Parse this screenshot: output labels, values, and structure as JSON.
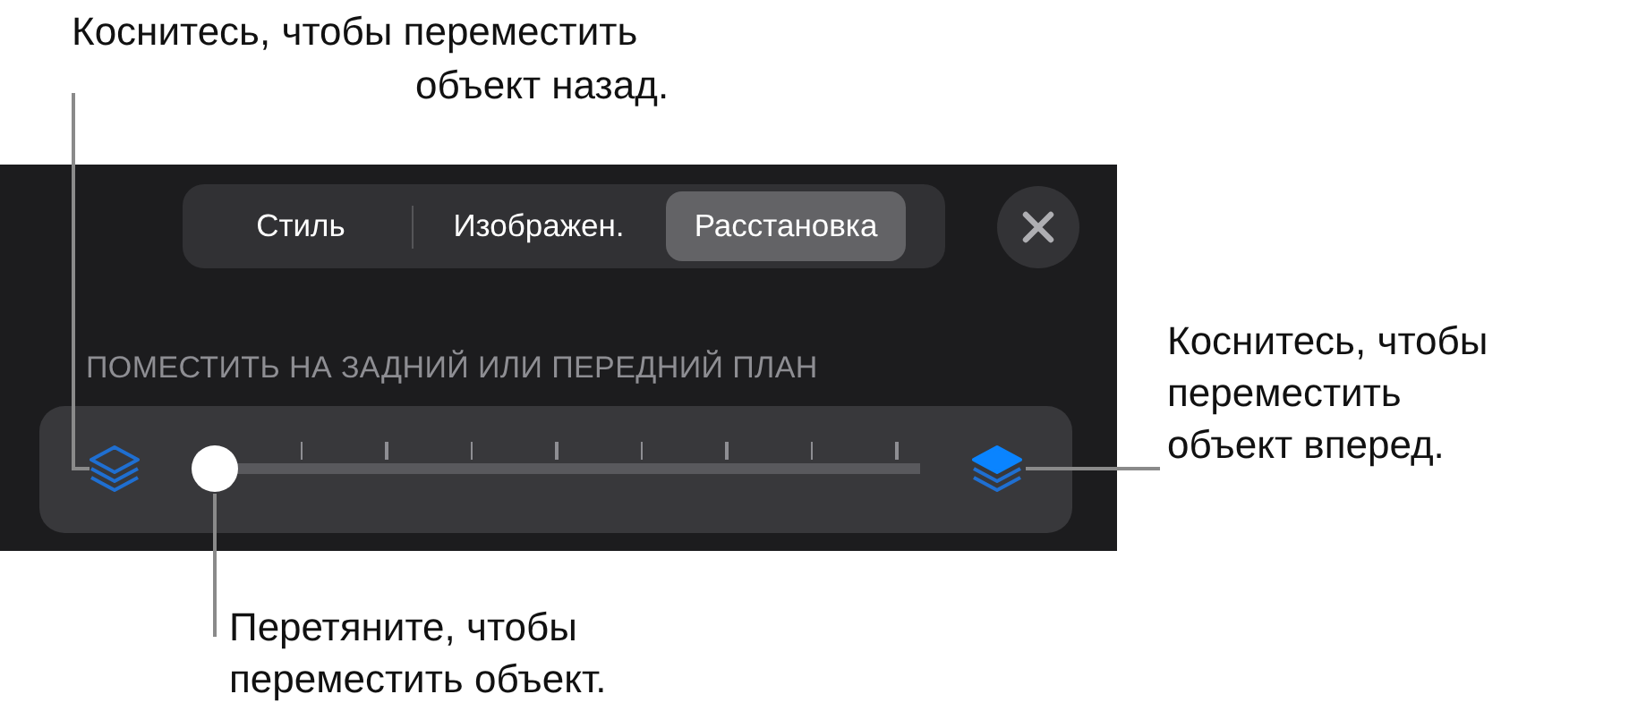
{
  "panel": {
    "tabs": [
      {
        "label": "Стиль",
        "selected": false
      },
      {
        "label": "Изображен.",
        "selected": false
      },
      {
        "label": "Расстановка",
        "selected": true
      }
    ],
    "section_header": "ПОМЕСТИТЬ НА ЗАДНИЙ ИЛИ ПЕРЕДНИЙ ПЛАН",
    "slider": {
      "level": 0
    }
  },
  "callouts": [
    {
      "kind": "top",
      "lines": [
        "Коснитесь, чтобы переместить",
        "объект назад."
      ]
    },
    {
      "kind": "right",
      "lines": [
        "Коснитесь, чтобы",
        "переместить",
        "объект вперед."
      ]
    },
    {
      "kind": "bottom",
      "lines": [
        "Перетяните, чтобы",
        "переместить объект."
      ]
    }
  ]
}
